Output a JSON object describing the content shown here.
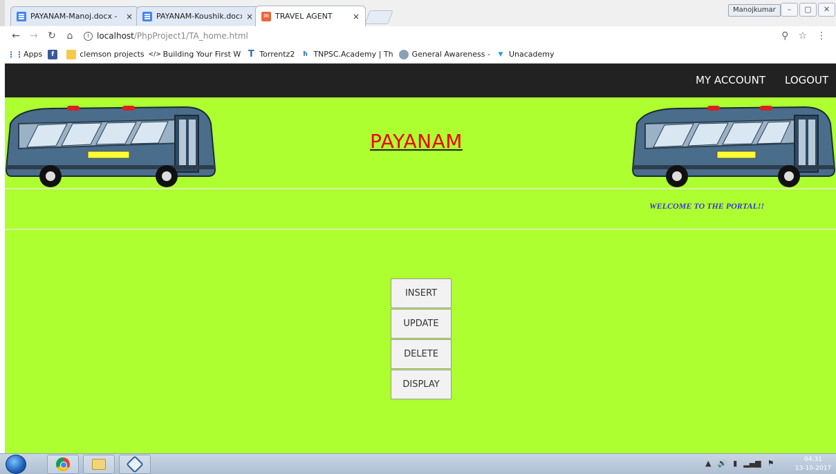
{
  "browser": {
    "tabs": [
      {
        "label": "PAYANAM-Manoj.docx -",
        "icon": "docs-icon",
        "close": "×"
      },
      {
        "label": "PAYANAM-Koushik.docx",
        "icon": "docs-icon",
        "close": "×"
      },
      {
        "label": "TRAVEL AGENT",
        "icon": "travel-agent-favicon",
        "close": "×"
      }
    ],
    "user_chip": "Manojkumar",
    "window_buttons": [
      "–",
      "▢",
      "✕"
    ],
    "url_host": "localhost",
    "url_path": "/PhpProject1/TA_home.html",
    "bookmarks": [
      {
        "label": "Apps",
        "icon": "apps-grid-icon"
      },
      {
        "label": "",
        "icon": "facebook-icon"
      },
      {
        "label": "clemson projects",
        "icon": "folder-icon"
      },
      {
        "label": "Building Your First W",
        "icon": "code-icon"
      },
      {
        "label": "Torrentz2",
        "icon": "torrentz-icon"
      },
      {
        "label": "TNPSC.Academy | Th",
        "icon": "tnpsc-icon"
      },
      {
        "label": "General Awareness -",
        "icon": "general-awareness-icon"
      },
      {
        "label": "Unacademy",
        "icon": "unacademy-icon"
      }
    ]
  },
  "navbar": {
    "my_account": "MY ACCOUNT",
    "logout": "LOGOUT"
  },
  "header": {
    "title": "PAYANAM",
    "welcome": "WELCOME TO THE PORTAL!!"
  },
  "actions": {
    "insert": "INSERT",
    "update": "UPDATE",
    "delete": "DELETE",
    "display": "DISPLAY"
  },
  "taskbar": {
    "time": "04:31",
    "date": "13-10-2017"
  },
  "colors": {
    "page_background": "#adff2f",
    "navbar_background": "#222222",
    "title_color": "#ee0000",
    "welcome_color": "#3a34d6"
  }
}
